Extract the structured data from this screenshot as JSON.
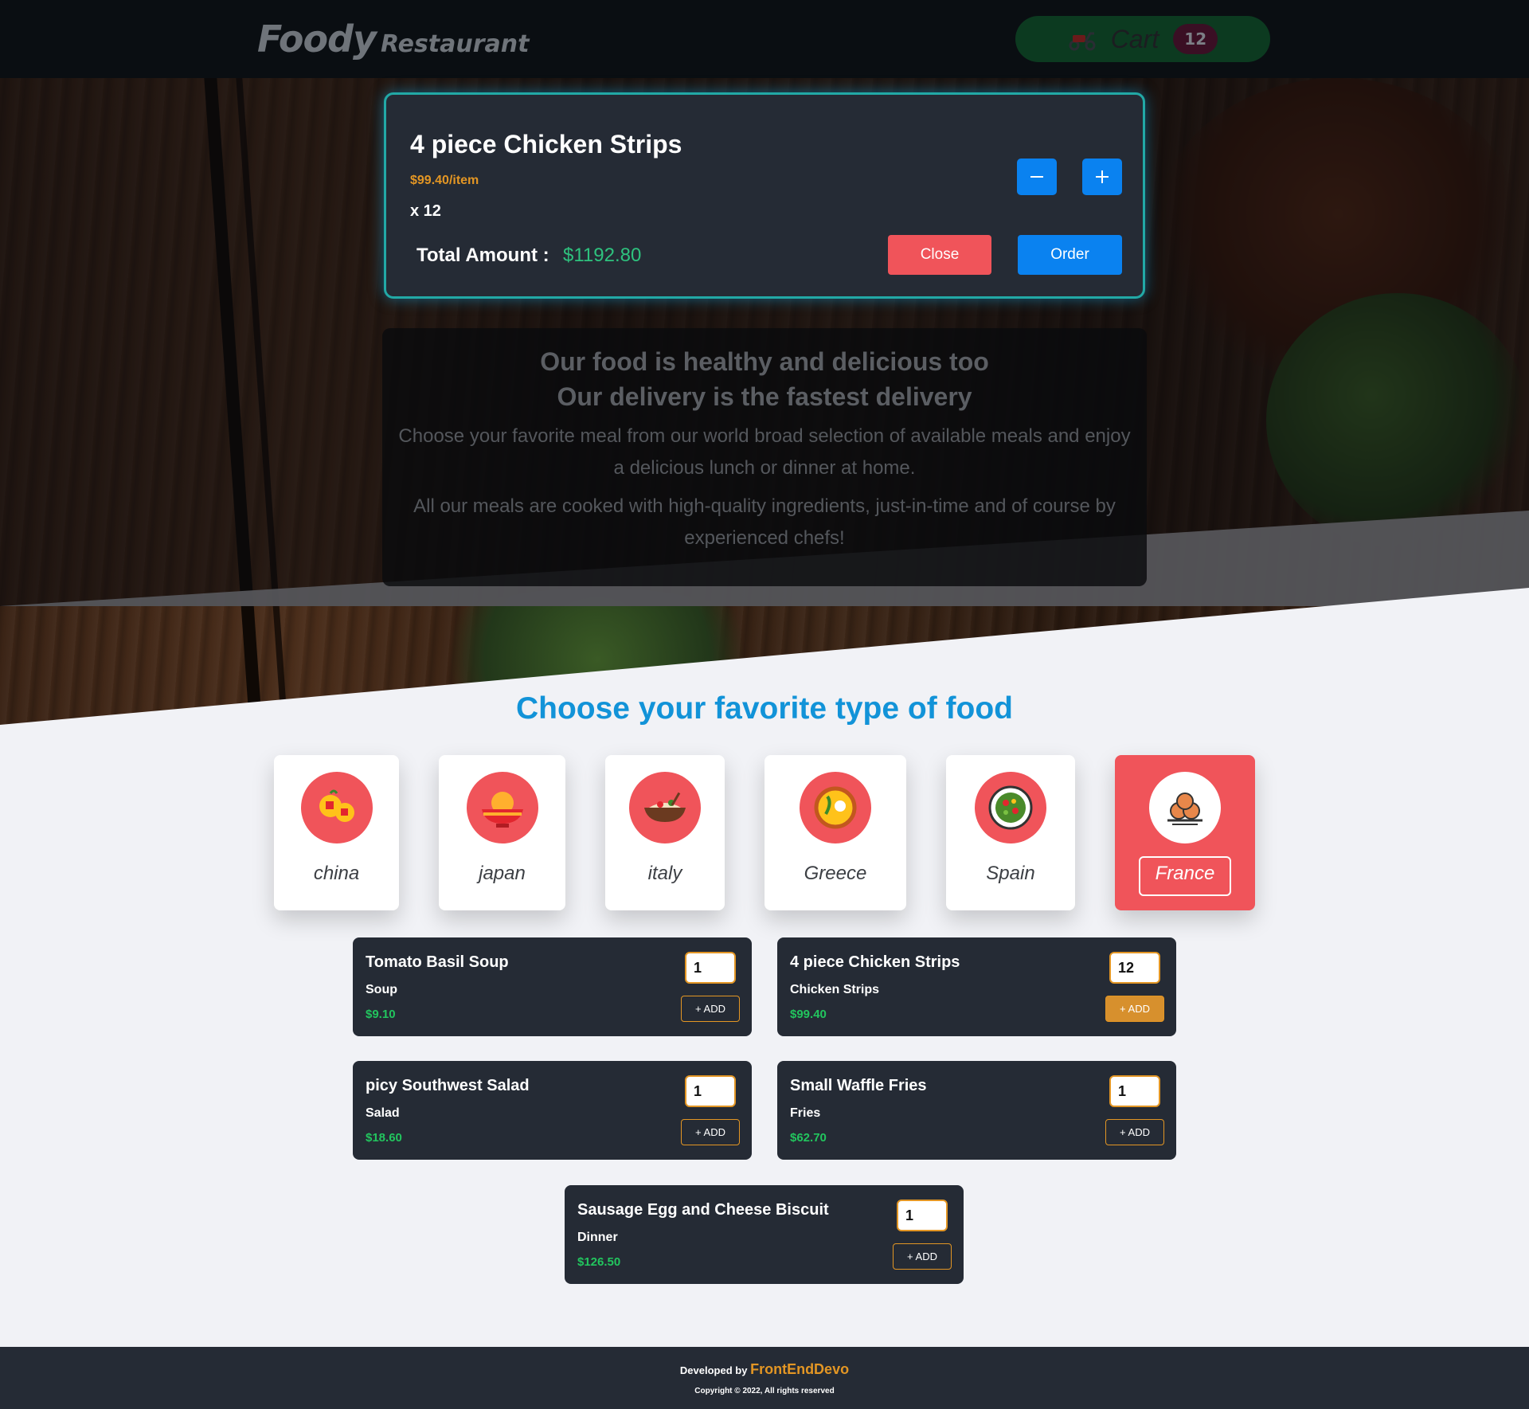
{
  "header": {
    "logo_main": "Foody",
    "logo_sub": "Restaurant",
    "cart_label": "Cart",
    "cart_count": "12"
  },
  "modal": {
    "title": "4 piece Chicken Strips",
    "price_per_item": "$99.40/item",
    "quantity": "x 12",
    "total_label": "Total Amount :",
    "total_value": "$1192.80",
    "minus_label": "–",
    "plus_label": "+",
    "close_label": "Close",
    "order_label": "Order"
  },
  "intro": {
    "line1": "Our food is healthy and delicious too",
    "line2": "Our delivery is the fastest delivery",
    "para1": "Choose your favorite meal from our world broad selection of available meals and enjoy a delicious lunch or dinner at home.",
    "para2": "All our meals are cooked with high-quality ingredients, just-in-time and of course by experienced chefs!"
  },
  "section_title": "Choose your favorite type of food",
  "categories": [
    {
      "label": "china",
      "icon": "oranges-icon"
    },
    {
      "label": "japan",
      "icon": "ramen-bowl-icon"
    },
    {
      "label": "italy",
      "icon": "pasta-bowl-icon"
    },
    {
      "label": "Greece",
      "icon": "paella-icon"
    },
    {
      "label": "Spain",
      "icon": "salad-plate-icon"
    },
    {
      "label": "France",
      "icon": "croquettes-icon",
      "active": true
    }
  ],
  "foods": [
    {
      "name": "Tomato Basil Soup",
      "category": "Soup",
      "price": "$9.10",
      "qty": "1",
      "add_label": "+ ADD"
    },
    {
      "name": "4 piece Chicken Strips",
      "category": "Chicken Strips",
      "price": "$99.40",
      "qty": "12",
      "add_label": "+ ADD",
      "active": true
    },
    {
      "name": "picy Southwest Salad",
      "category": "Salad",
      "price": "$18.60",
      "qty": "1",
      "add_label": "+ ADD"
    },
    {
      "name": "Small Waffle Fries",
      "category": "Fries",
      "price": "$62.70",
      "qty": "1",
      "add_label": "+ ADD"
    },
    {
      "name": "Sausage Egg and Cheese Biscuit",
      "category": "Dinner",
      "price": "$126.50",
      "qty": "1",
      "add_label": "+ ADD"
    }
  ],
  "footer": {
    "developed_by": "Developed by",
    "brand": "FrontEndDevo",
    "copyright": "Copyright © 2022, All rights reserved"
  },
  "colors": {
    "accent_blue": "#0a82f0",
    "accent_red": "#f0545a",
    "accent_orange": "#e39624",
    "price_green": "#22c55e",
    "card_bg": "#252b35"
  }
}
